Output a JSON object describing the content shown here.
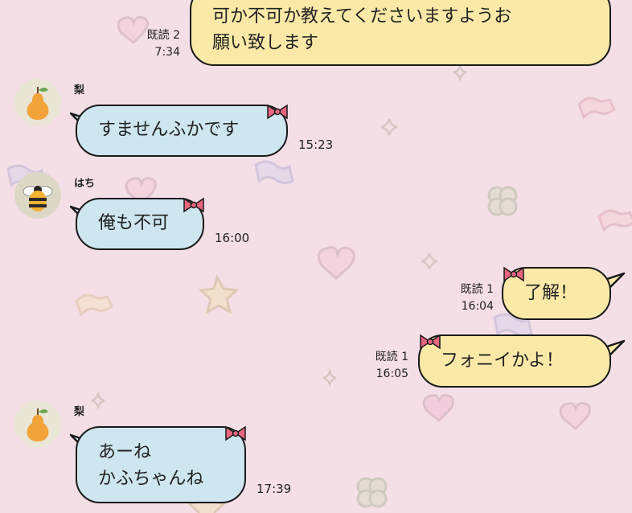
{
  "messages": [
    {
      "side": "right",
      "read": "既読 2",
      "time": "7:34",
      "lines": [
        "可か不可か教えてくださいますようお",
        "願い致します"
      ]
    },
    {
      "side": "left",
      "sender": "梨",
      "time": "15:23",
      "lines": [
        "すませんふかです"
      ]
    },
    {
      "side": "left",
      "sender": "はち",
      "time": "16:00",
      "lines": [
        "俺も不可"
      ]
    },
    {
      "side": "right",
      "read": "既読 1",
      "time": "16:04",
      "lines": [
        "了解！"
      ]
    },
    {
      "side": "right",
      "read": "既読 1",
      "time": "16:05",
      "lines": [
        "フォニイかよ！"
      ]
    },
    {
      "side": "left",
      "sender": "梨",
      "time": "17:39",
      "lines": [
        "あーね",
        "かふちゃんね"
      ]
    }
  ],
  "icons": {
    "pear": "pear-avatar-icon",
    "bee": "bee-avatar-icon",
    "bow": "ribbon-bow-icon"
  },
  "colors": {
    "background": "#f5dfe6",
    "incoming_bubble": "#cde6f0",
    "outgoing_bubble": "#fbe9a8",
    "bow": "#e8657f"
  }
}
